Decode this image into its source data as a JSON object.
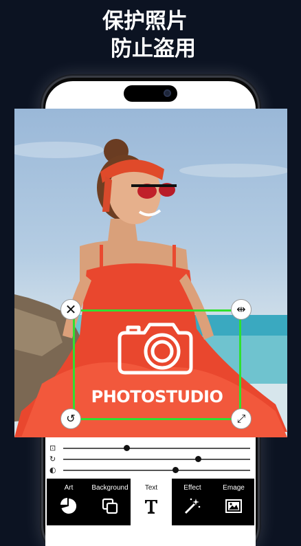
{
  "headline": {
    "line1": "保护照片",
    "line2": "防止盗用"
  },
  "editor": {
    "watermark_text": "PHOTOSTUDIO",
    "selection_color": "#30e030"
  },
  "sliders": [
    {
      "name": "size",
      "value": 0.34
    },
    {
      "name": "rotation",
      "value": 0.72
    },
    {
      "name": "opacity",
      "value": 0.6
    }
  ],
  "tabs": [
    {
      "label": "Art",
      "icon": "pie-chart-icon",
      "active": false
    },
    {
      "label": "Background",
      "icon": "layers-icon",
      "active": false
    },
    {
      "label": "Text",
      "icon": "text-icon",
      "active": true
    },
    {
      "label": "Effect",
      "icon": "magic-wand-icon",
      "active": false
    },
    {
      "label": "Emage",
      "icon": "image-icon",
      "active": false
    }
  ]
}
